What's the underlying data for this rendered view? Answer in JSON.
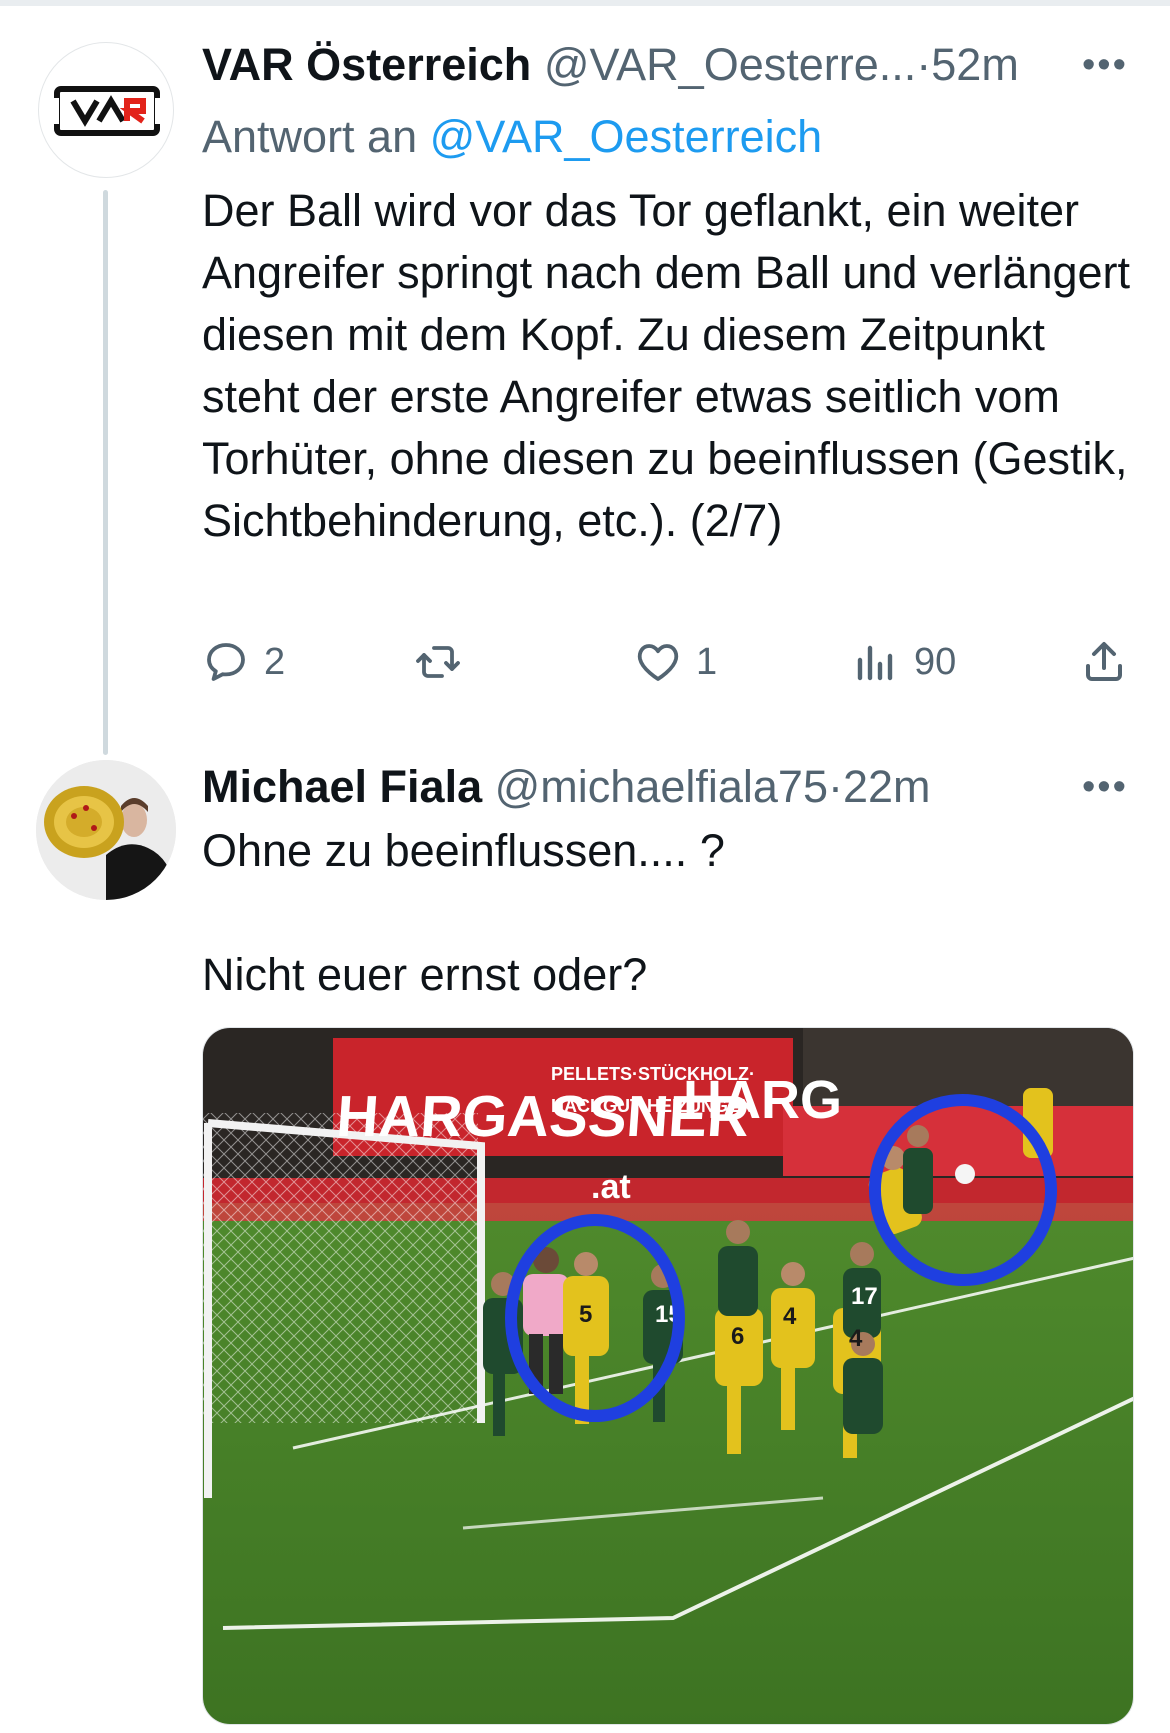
{
  "tweets": [
    {
      "author_name": "VAR Österreich",
      "handle": "@VAR_Oesterre...",
      "separator": "·",
      "time": "52m",
      "reply_prefix": "Antwort an",
      "reply_mention": "@VAR_Oesterreich",
      "text": "Der Ball wird vor das Tor geflankt, ein weiter Angreifer springt nach dem Ball und verlängert diesen mit dem Kopf. Zu diesem Zeitpunkt steht der erste Angreifer etwas seitlich vom Torhüter, ohne diesen zu beeinflussen (Gestik, Sichtbehinderung, etc.). (2/7)",
      "avatar_logo_text": "VAR",
      "actions": {
        "replies": "2",
        "retweets": "",
        "likes": "1",
        "views": "90"
      }
    },
    {
      "author_name": "Michael Fiala",
      "handle": "@michaelfiala75",
      "separator": "·",
      "time": "22m",
      "text": "Ohne zu beeinflussen.... ?\n\nNicht euer ernst oder?",
      "media": {
        "banner_main": "HARGASSNER",
        "banner_line1": "PELLETS·STÜCKHOLZ·",
        "banner_line2": "HACKGUT·HEIZUNGEN",
        "banner_right": "HARG",
        "board_text": ".at",
        "jersey_numbers": [
          "5",
          "15",
          "4",
          "6",
          "4",
          "17"
        ]
      }
    }
  ],
  "icons": {
    "more": "more-dots-icon",
    "reply": "reply-bubble-icon",
    "retweet": "retweet-icon",
    "like": "heart-icon",
    "views": "views-bar-chart-icon",
    "share": "share-upload-icon"
  },
  "colors": {
    "text_primary": "#0f1419",
    "text_secondary": "#536471",
    "link": "#1d9bf0",
    "thread_line": "#cfd9de",
    "annotation_circle": "#1f3fe0"
  }
}
